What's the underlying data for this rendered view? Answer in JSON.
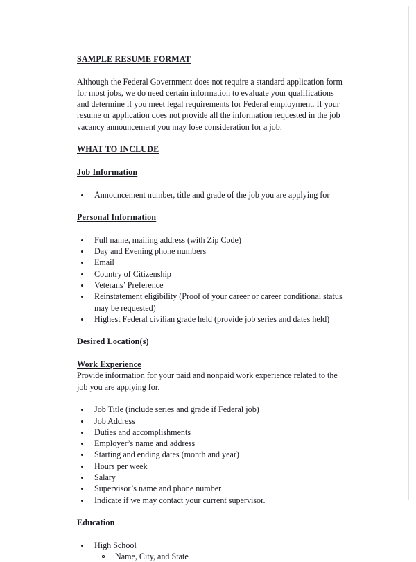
{
  "document": {
    "title": "SAMPLE RESUME FORMAT",
    "intro_paragraph": "Although the Federal Government does not require a standard application form for most jobs, we do need certain information to evaluate your qualifications and determine if you meet legal requirements for Federal employment. If your resume or application does not provide all the information requested in the job vacancy announcement you may lose consideration for a job.",
    "what_to_include_heading": "WHAT TO INCLUDE ",
    "sections": {
      "job_information": {
        "heading": "Job Information",
        "bullets": [
          "Announcement number, title and grade of the job you are applying for"
        ]
      },
      "personal_information": {
        "heading": "Personal Information",
        "bullets": [
          "Full name, mailing address (with Zip Code)",
          "Day and Evening phone numbers",
          "Email",
          "Country of Citizenship",
          "Veterans’ Preference",
          "Reinstatement eligibility (Proof of your career or career conditional status may be requested)",
          "Highest Federal civilian grade held (provide job series and dates held)"
        ]
      },
      "desired_locations": {
        "heading": "Desired Location(s)"
      },
      "work_experience": {
        "heading": "Work Experience",
        "intro": "Provide information for your paid and nonpaid work experience related to the job you are applying for.",
        "bullets": [
          "Job Title (include series and grade if Federal job)",
          "Job Address",
          "Duties and accomplishments",
          "Employer’s name and address",
          "Starting and ending dates (month and year)",
          "Hours per week",
          "Salary",
          "Supervisor’s name and phone number",
          "Indicate if we may contact your current supervisor."
        ]
      },
      "education": {
        "heading": "Education",
        "bullets": [
          "High School"
        ],
        "subbullets": [
          "Name, City, and State"
        ]
      }
    }
  }
}
